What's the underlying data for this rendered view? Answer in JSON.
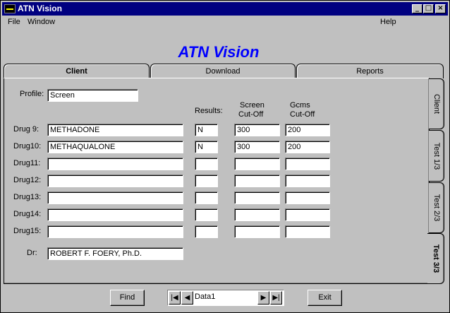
{
  "window": {
    "title": "ATN Vision",
    "minimize_glyph": "_",
    "maximize_glyph": "□",
    "close_glyph": "×"
  },
  "menu": {
    "file": "File",
    "window": "Window",
    "help": "Help"
  },
  "banner": "ATN Vision",
  "tabs_top": [
    {
      "label": "Client"
    },
    {
      "label": "Download"
    },
    {
      "label": "Reports"
    }
  ],
  "tabs_side": [
    {
      "label": "Client"
    },
    {
      "label": "Test 1/3"
    },
    {
      "label": "Test 2/3"
    },
    {
      "label": "Test 3/3"
    }
  ],
  "form": {
    "profile_label": "Profile:",
    "profile_value": "Screen",
    "results_header": "Results:",
    "screen_header_1": "Screen",
    "screen_header_2": "Cut-Off",
    "gcms_header_1": "Gcms",
    "gcms_header_2": "Cut-Off",
    "drugs": [
      {
        "label": "Drug  9:",
        "name": "METHADONE",
        "result": "N",
        "screen": "300",
        "gcms": "200"
      },
      {
        "label": "Drug10:",
        "name": "METHAQUALONE",
        "result": "N",
        "screen": "300",
        "gcms": "200"
      },
      {
        "label": "Drug11:",
        "name": "",
        "result": "",
        "screen": "",
        "gcms": ""
      },
      {
        "label": "Drug12:",
        "name": "",
        "result": "",
        "screen": "",
        "gcms": ""
      },
      {
        "label": "Drug13:",
        "name": "",
        "result": "",
        "screen": "",
        "gcms": ""
      },
      {
        "label": "Drug14:",
        "name": "",
        "result": "",
        "screen": "",
        "gcms": ""
      },
      {
        "label": "Drug15:",
        "name": "",
        "result": "",
        "screen": "",
        "gcms": ""
      }
    ],
    "dr_label": "Dr:",
    "dr_value": "ROBERT F. FOERY, Ph.D."
  },
  "footer": {
    "find": "Find",
    "exit": "Exit",
    "data_name": "Data1",
    "first_glyph": "|◀",
    "prev_glyph": "◀",
    "next_glyph": "▶",
    "last_glyph": "▶|"
  }
}
